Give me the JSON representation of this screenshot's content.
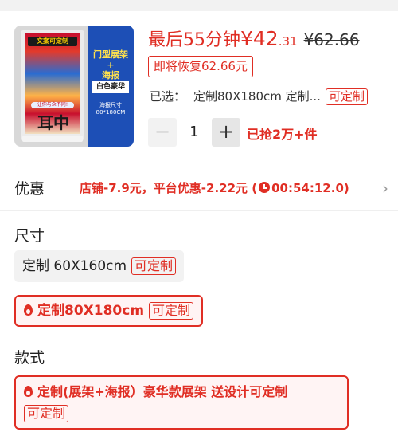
{
  "product": {
    "image_alt": "门型展架海报",
    "poster_title": "文案可定制",
    "poster_callout": "让你与众不同!",
    "poster_big": "耳中",
    "info_title_line1": "门型展架",
    "info_title_line2": "+",
    "info_title_line3": "海报",
    "info_tag": "白色豪华",
    "info_size_label": "海报尺寸",
    "info_size_value": "80*180CM"
  },
  "price": {
    "prefix": "最后55分钟",
    "currency": "¥",
    "integer": "42",
    "cents": ".31",
    "original": "¥62.66",
    "restore_badge": "即将恢复62.66元"
  },
  "selection": {
    "label": "已选：",
    "value": "定制80X180cm 定制...",
    "custom_tag": "可定制"
  },
  "quantity": {
    "minus": "−",
    "value": "1",
    "plus": "+",
    "sold": "已抢2万+件"
  },
  "promo": {
    "label": "优惠",
    "text_before": "店铺-7.9元，平台优惠-2.22元 (",
    "timer": "00:54:12.0",
    "text_after": ")",
    "chevron": "›"
  },
  "size": {
    "title": "尺寸",
    "options": [
      {
        "label": "定制 60X160cm",
        "tag": "可定制",
        "selected": false
      },
      {
        "label": "定制80X180cm",
        "tag": "可定制",
        "selected": true
      }
    ]
  },
  "style": {
    "title": "款式",
    "options": [
      {
        "label": "定制(展架+海报）豪华款展架 送设计可定制",
        "tag": "可定制",
        "selected": true
      }
    ]
  },
  "colors": {
    "accent": "#e02e24",
    "selected_bg": "#fff4f4",
    "chip_bg": "#f2f2f2"
  }
}
